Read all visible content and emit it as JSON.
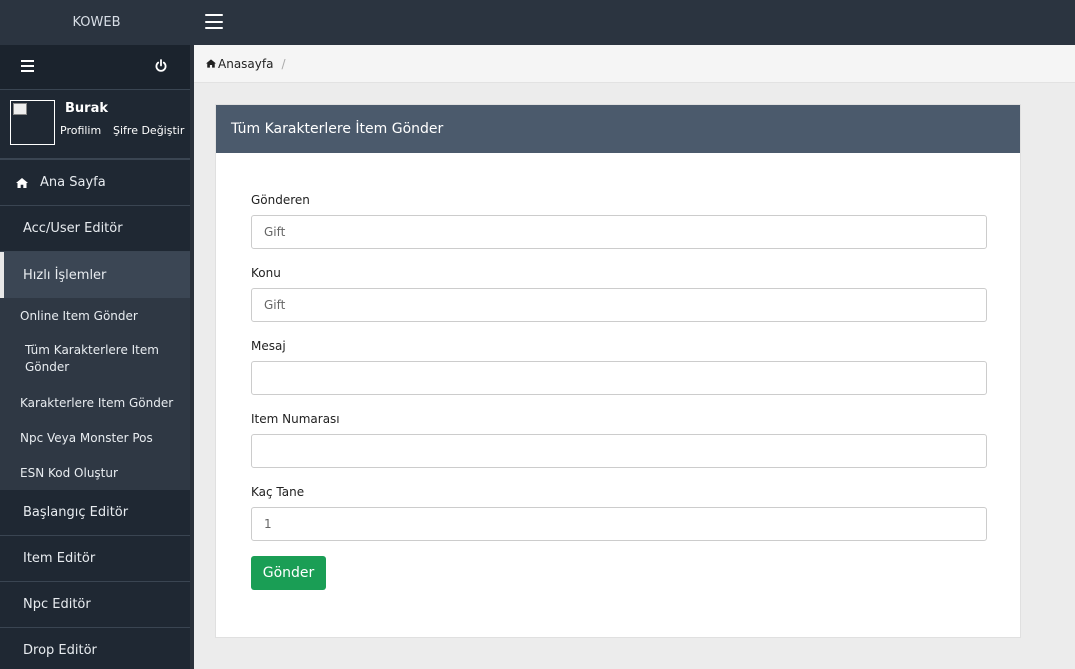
{
  "brand": "KOWEB",
  "user": {
    "name": "Burak",
    "profile_link": "Profilim",
    "password_link": "Şifre Değiştir"
  },
  "sidebar": {
    "home": "Ana Sayfa",
    "items": [
      {
        "label": "Acc/User Editör"
      },
      {
        "label": "Hızlı İşlemler"
      }
    ],
    "submenu": [
      {
        "label": "Online Item Gönder"
      },
      {
        "label": "Tüm Karakterlere Item Gönder"
      },
      {
        "label": "Karakterlere Item Gönder"
      },
      {
        "label": "Npc Veya Monster Pos"
      },
      {
        "label": "ESN Kod Oluştur"
      }
    ],
    "items_after": [
      {
        "label": "Başlangıç Editör"
      },
      {
        "label": "Item Editör"
      },
      {
        "label": "Npc Editör"
      },
      {
        "label": "Drop Editör"
      }
    ]
  },
  "breadcrumb": {
    "home": "Anasayfa",
    "separator": "/"
  },
  "panel": {
    "title": "Tüm Karakterlere İtem Gönder"
  },
  "form": {
    "sender": {
      "label": "Gönderen",
      "value": "Gift"
    },
    "subject": {
      "label": "Konu",
      "value": "Gift"
    },
    "message": {
      "label": "Mesaj",
      "value": ""
    },
    "item_number": {
      "label": "Item Numarası",
      "value": ""
    },
    "quantity": {
      "label": "Kaç Tane",
      "value": "1"
    },
    "submit": "Gönder"
  },
  "colors": {
    "topbar": "#2b3440",
    "sidebar": "#1f2833",
    "panel_header": "#4b5a6c",
    "submit": "#1a9e55"
  }
}
